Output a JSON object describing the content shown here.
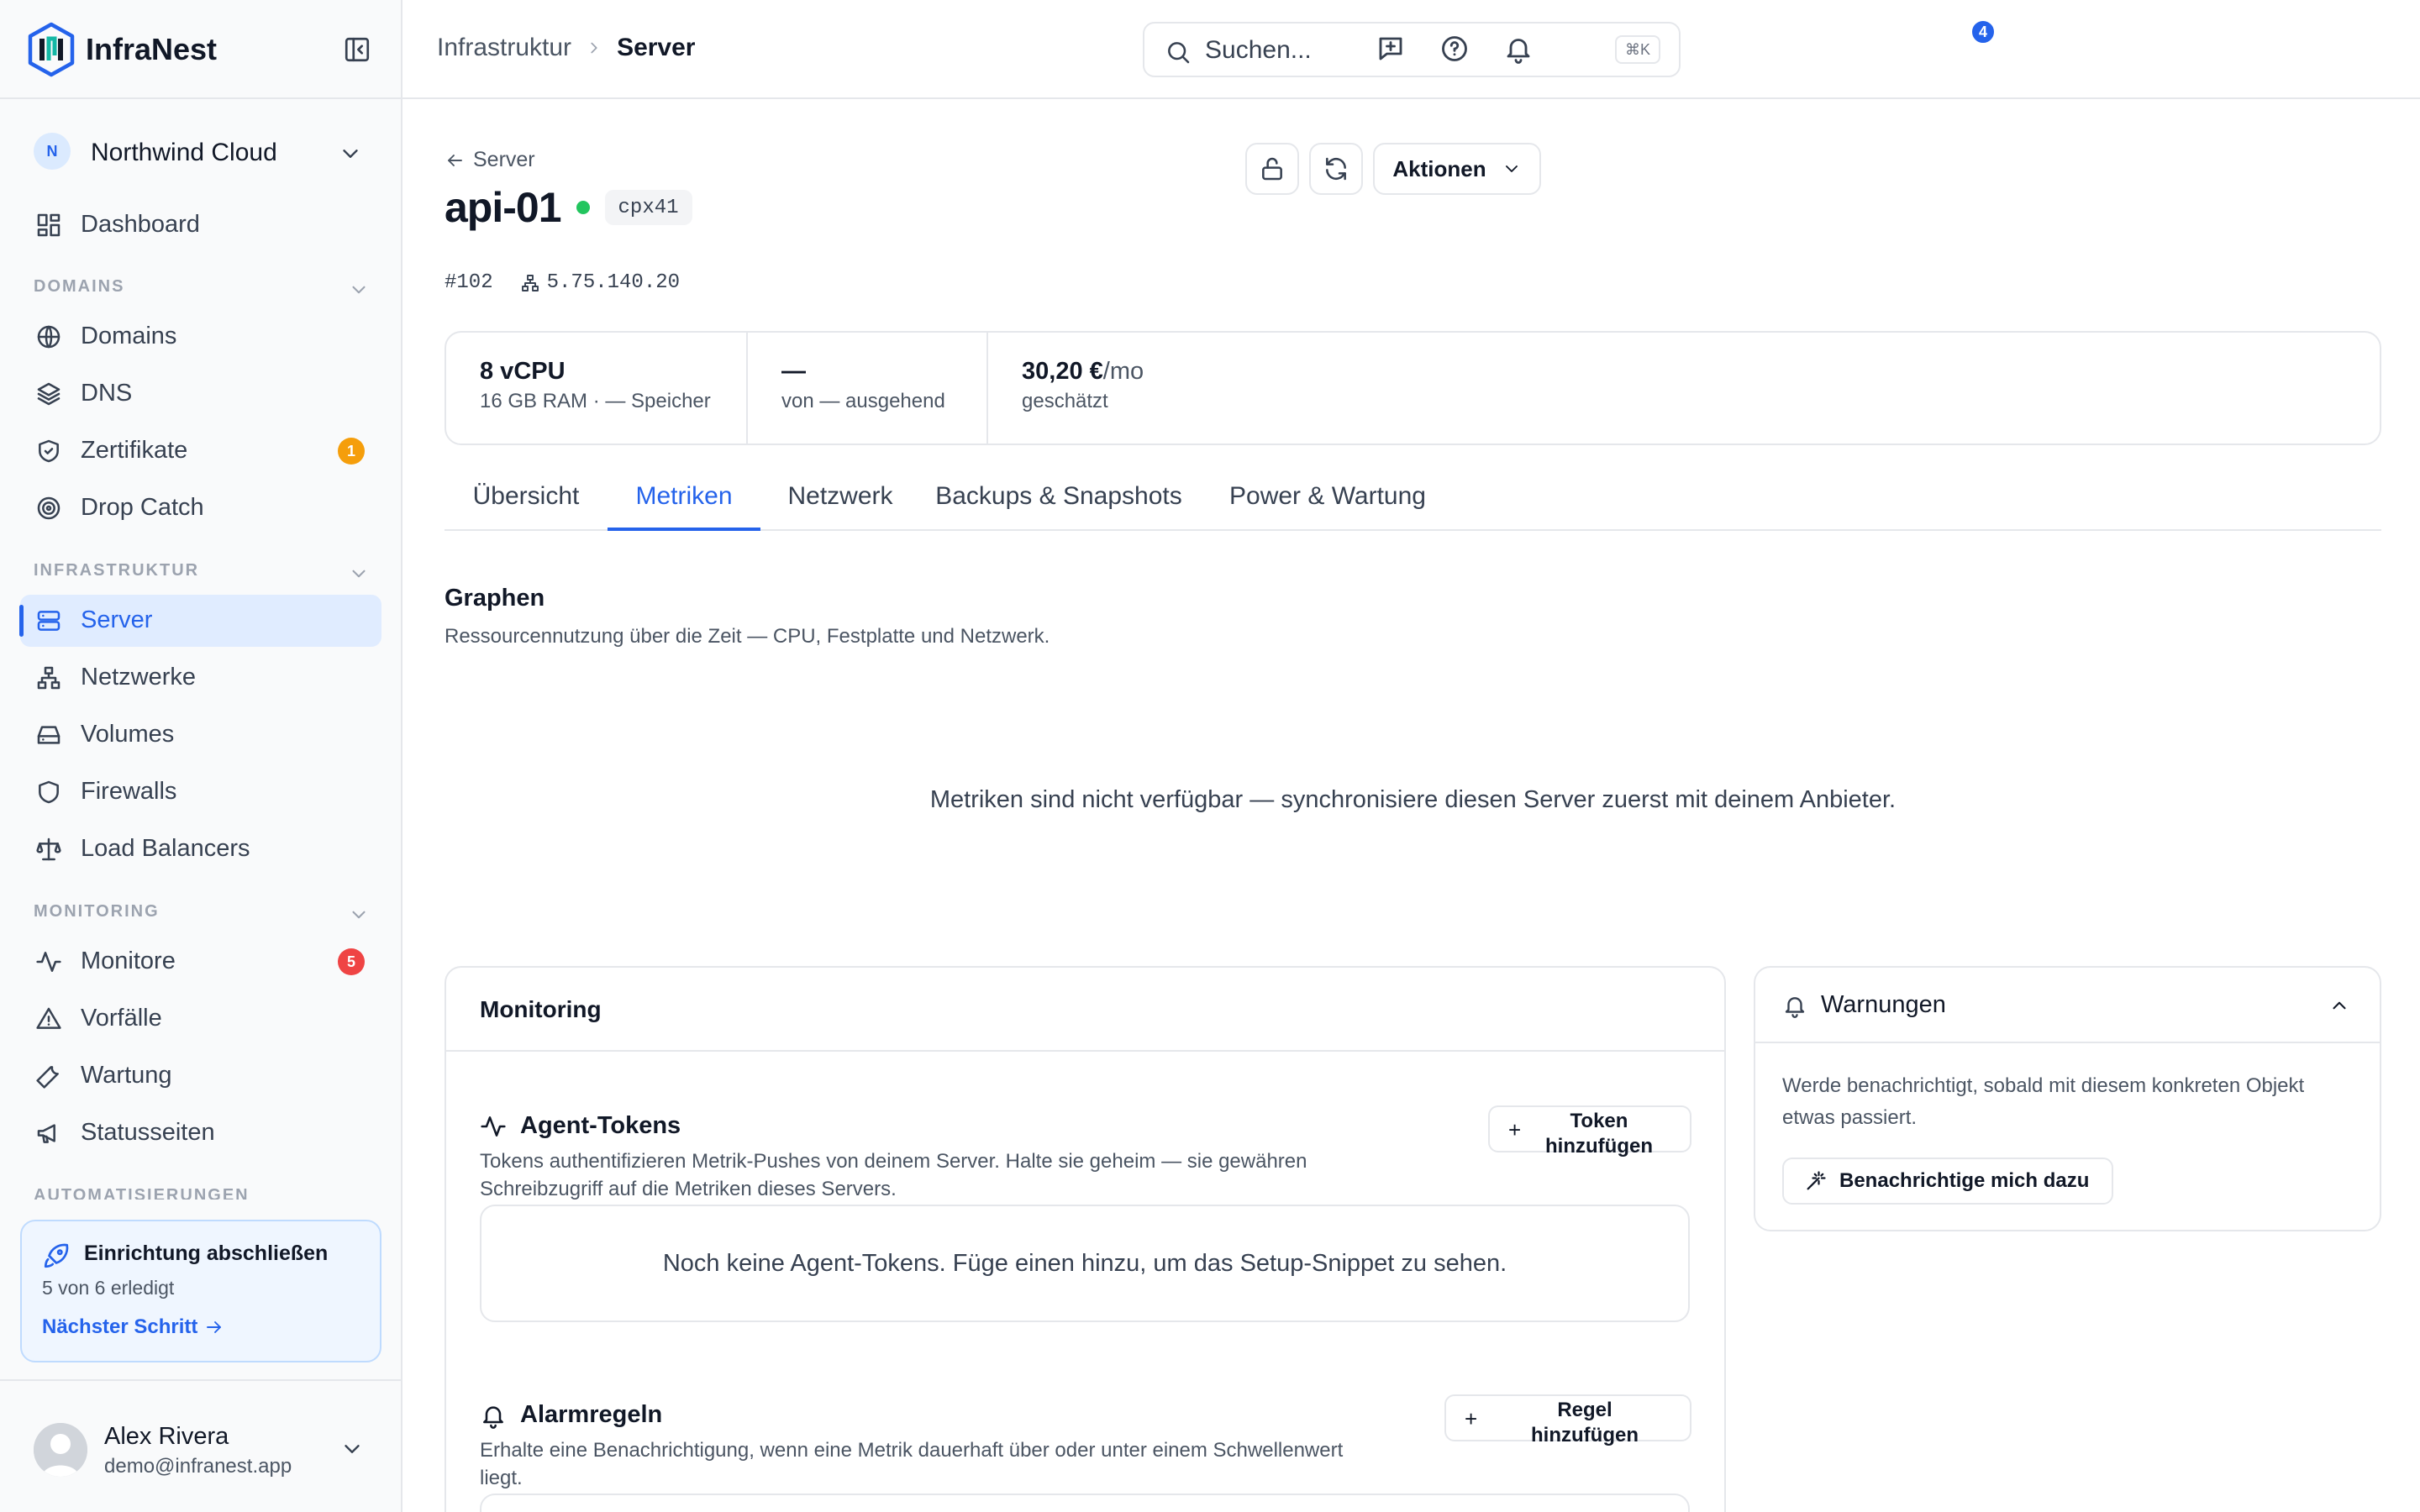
{
  "brand": {
    "name": "InfraNest"
  },
  "org": {
    "initial": "N",
    "name": "Northwind Cloud"
  },
  "nav": {
    "dashboard": "Dashboard",
    "sections": {
      "domains": "DOMAINS",
      "infrastruktur": "INFRASTRUKTUR",
      "monitoring": "MONITORING",
      "automatisierungen": "AUTOMATISIERUNGEN"
    },
    "domains_items": [
      {
        "label": "Domains",
        "icon": "globe-icon"
      },
      {
        "label": "DNS",
        "icon": "layers-icon"
      },
      {
        "label": "Zertifikate",
        "icon": "shield-check-icon",
        "badge": "1"
      },
      {
        "label": "Drop Catch",
        "icon": "target-icon"
      }
    ],
    "infra_items": [
      {
        "label": "Server",
        "icon": "server-icon",
        "active": true
      },
      {
        "label": "Netzwerke",
        "icon": "network-icon"
      },
      {
        "label": "Volumes",
        "icon": "hard-drive-icon"
      },
      {
        "label": "Firewalls",
        "icon": "shield-icon"
      },
      {
        "label": "Load Balancers",
        "icon": "scale-icon"
      }
    ],
    "monitoring_items": [
      {
        "label": "Monitore",
        "icon": "activity-icon",
        "badge": "5"
      },
      {
        "label": "Vorfälle",
        "icon": "warning-icon"
      },
      {
        "label": "Wartung",
        "icon": "wrench-icon"
      },
      {
        "label": "Statusseiten",
        "icon": "megaphone-icon"
      }
    ]
  },
  "setup": {
    "title": "Einrichtung abschließen",
    "progress": "5 von 6 erledigt",
    "next": "Nächster Schritt"
  },
  "user": {
    "name": "Alex Rivera",
    "email": "demo@infranest.app"
  },
  "topbar": {
    "breadcrumb": [
      "Infrastruktur",
      "Server"
    ],
    "search_placeholder": "Suchen...",
    "search_shortcut": "⌘K",
    "notifications_count": "4"
  },
  "server": {
    "back_label": "Server",
    "name": "api-01",
    "type": "cpx41",
    "id": "#102",
    "ip": "5.75.140.20",
    "actions_label": "Aktionen",
    "stats": [
      {
        "value": "8 vCPU",
        "label": "16 GB RAM · — Speicher"
      },
      {
        "value": "—",
        "label": "von — ausgehend"
      },
      {
        "value": "30,20 €",
        "unit": "/mo",
        "label": "geschätzt"
      }
    ]
  },
  "tabs": [
    "Übersicht",
    "Metriken",
    "Netzwerk",
    "Backups & Snapshots",
    "Power & Wartung"
  ],
  "active_tab": "Metriken",
  "graphs": {
    "title": "Graphen",
    "subtitle": "Ressourcennutzung über die Zeit — CPU, Festplatte und Netzwerk.",
    "empty": "Metriken sind nicht verfügbar — synchronisiere diesen Server zuerst mit deinem Anbieter."
  },
  "monitoring": {
    "title": "Monitoring",
    "agent_tokens": {
      "title": "Agent-Tokens",
      "description": "Tokens authentifizieren Metrik-Pushes von deinem Server. Halte sie geheim — sie gewähren Schreibzugriff auf die Metriken dieses Servers.",
      "button": "Token hinzufügen",
      "empty": "Noch keine Agent-Tokens. Füge einen hinzu, um das Setup-Snippet zu sehen."
    },
    "alarm_rules": {
      "title": "Alarmregeln",
      "description": "Erhalte eine Benachrichtigung, wenn eine Metrik dauerhaft über oder unter einem Schwellenwert liegt.",
      "button": "Regel hinzufügen"
    }
  },
  "warnings": {
    "title": "Warnungen",
    "body": "Werde benachrichtigt, sobald mit diesem konkreten Objekt etwas passiert.",
    "button": "Benachrichtige mich dazu"
  },
  "colors": {
    "accent": "#2563eb",
    "status_online": "#22c55e",
    "badge_warning": "#f59e0b",
    "badge_danger": "#ef4444"
  }
}
